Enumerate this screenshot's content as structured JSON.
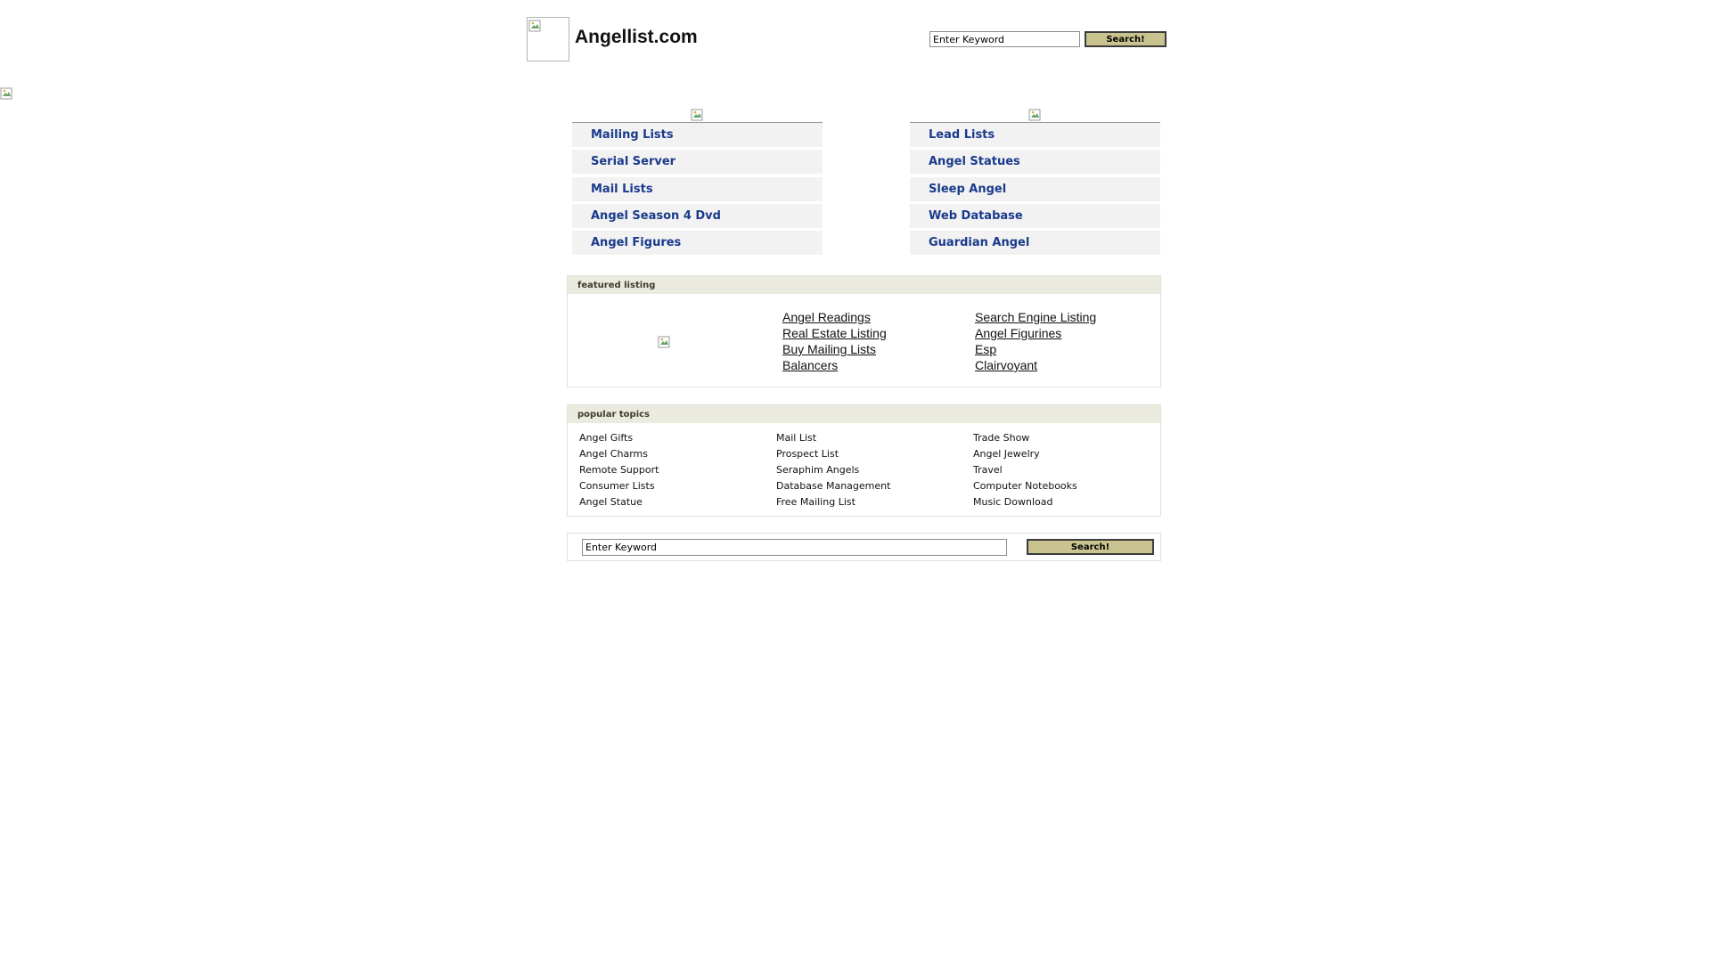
{
  "header": {
    "site_title": "Angellist.com",
    "search_placeholder": "Enter Keyword",
    "search_button": "Search!"
  },
  "nav_left": [
    {
      "label": "Mailing Lists"
    },
    {
      "label": "Serial Server"
    },
    {
      "label": "Mail Lists"
    },
    {
      "label": "Angel Season 4 Dvd"
    },
    {
      "label": "Angel Figures"
    }
  ],
  "nav_right": [
    {
      "label": "Lead Lists"
    },
    {
      "label": "Angel Statues"
    },
    {
      "label": "Sleep Angel"
    },
    {
      "label": "Web Database"
    },
    {
      "label": "Guardian Angel"
    }
  ],
  "featured": {
    "heading": "featured listing",
    "col1": [
      "Angel Readings",
      "Real Estate Listing",
      "Buy Mailing Lists",
      "Balancers"
    ],
    "col2": [
      "Search Engine Listing",
      "Angel Figurines",
      "Esp",
      "Clairvoyant"
    ]
  },
  "popular": {
    "heading": "popular topics",
    "col1": [
      "Angel Gifts",
      "Angel Charms",
      "Remote Support",
      "Consumer Lists",
      "Angel Statue"
    ],
    "col2": [
      "Mail List",
      "Prospect List",
      "Seraphim Angels",
      "Database Management",
      "Free Mailing List"
    ],
    "col3": [
      "Trade Show",
      "Angel Jewelry",
      "Travel",
      "Computer Notebooks",
      "Music Download"
    ]
  },
  "bottom_search": {
    "placeholder": "Enter Keyword",
    "button": "Search!"
  },
  "colors": {
    "nav_link": "#1a3a8c",
    "nav_item_bg": "#f2f2f2",
    "panel_head_bg": "#eaebde",
    "button_bg": "#c9c48f"
  }
}
